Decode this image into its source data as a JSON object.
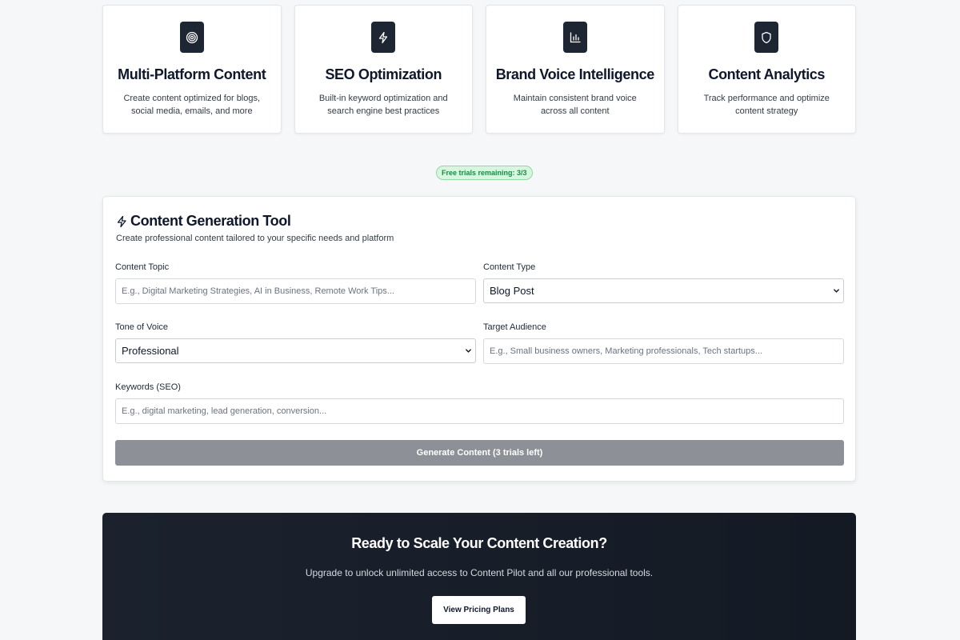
{
  "features": [
    {
      "icon": "target-icon",
      "title": "Multi-Platform Content",
      "desc": "Create content optimized for blogs, social media, emails, and more"
    },
    {
      "icon": "lightning-icon",
      "title": "SEO Optimization",
      "desc": "Built-in keyword optimization and search engine best practices"
    },
    {
      "icon": "bar-chart-icon",
      "title": "Brand Voice Intelligence",
      "desc": "Maintain consistent brand voice across all content"
    },
    {
      "icon": "shield-icon",
      "title": "Content Analytics",
      "desc": "Track performance and optimize content strategy"
    }
  ],
  "trials_badge": "Free trials remaining: 3/3",
  "tool": {
    "icon": "lightning-icon",
    "title": "Content Generation Tool",
    "subtitle": "Create professional content tailored to your specific needs and platform",
    "topic": {
      "label": "Content Topic",
      "value": "",
      "placeholder": "E.g., Digital Marketing Strategies, AI in Business, Remote Work Tips..."
    },
    "content_type": {
      "label": "Content Type",
      "selected": "Blog Post"
    },
    "tone": {
      "label": "Tone of Voice",
      "selected": "Professional"
    },
    "audience": {
      "label": "Target Audience",
      "value": "",
      "placeholder": "E.g., Small business owners, Marketing professionals, Tech startups..."
    },
    "keywords": {
      "label": "Keywords (SEO)",
      "value": "",
      "placeholder": "E.g., digital marketing, lead generation, conversion..."
    },
    "generate_label": "Generate Content (3 trials left)"
  },
  "cta": {
    "title": "Ready to Scale Your Content Creation?",
    "subtitle": "Upgrade to unlock unlimited access to Content Pilot and all our professional tools.",
    "button_label": "View Pricing Plans"
  },
  "colors": {
    "accent_dark": "#1e2633",
    "badge_bg": "#d7f5df",
    "badge_text": "#1c8a43",
    "button_disabled": "#8d9197"
  }
}
